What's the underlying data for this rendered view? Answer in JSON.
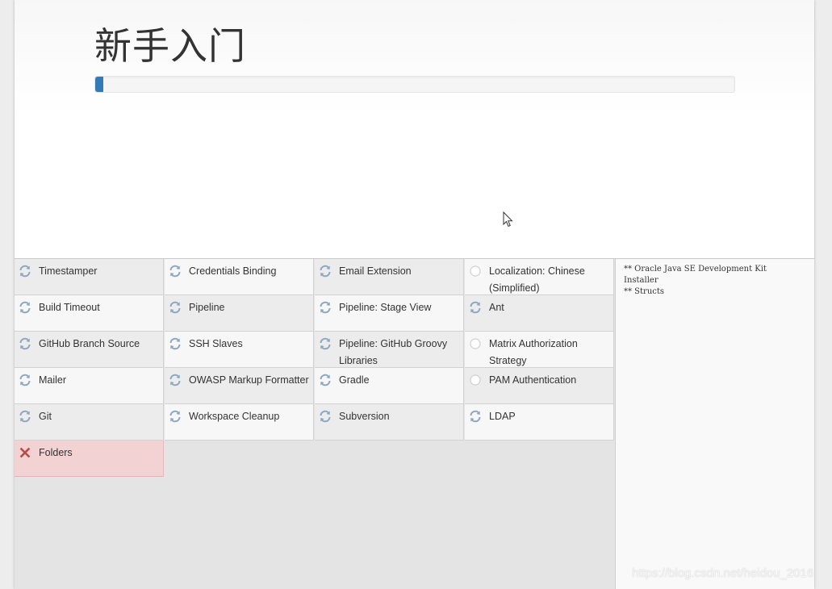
{
  "page": {
    "title": "新手入门",
    "progress_fraction": 0.012,
    "accent_color": "#337ab7"
  },
  "plugins": [
    {
      "label": "Timestamper",
      "status": "installing"
    },
    {
      "label": "Credentials Binding",
      "status": "installing"
    },
    {
      "label": "Email Extension",
      "status": "installing"
    },
    {
      "label": "Localization: Chinese (Simplified)",
      "status": "pending"
    },
    {
      "label": "Build Timeout",
      "status": "installing"
    },
    {
      "label": "Pipeline",
      "status": "installing"
    },
    {
      "label": "Pipeline: Stage View",
      "status": "installing"
    },
    {
      "label": "Ant",
      "status": "installing"
    },
    {
      "label": "GitHub Branch Source",
      "status": "installing"
    },
    {
      "label": "SSH Slaves",
      "status": "installing"
    },
    {
      "label": "Pipeline: GitHub Groovy Libraries",
      "status": "installing"
    },
    {
      "label": "Matrix Authorization Strategy",
      "status": "pending"
    },
    {
      "label": "Mailer",
      "status": "installing"
    },
    {
      "label": "OWASP Markup Formatter",
      "status": "installing"
    },
    {
      "label": "Gradle",
      "status": "installing"
    },
    {
      "label": "PAM Authentication",
      "status": "pending"
    },
    {
      "label": "Git",
      "status": "installing"
    },
    {
      "label": "Workspace Cleanup",
      "status": "installing"
    },
    {
      "label": "Subversion",
      "status": "installing"
    },
    {
      "label": "LDAP",
      "status": "installing"
    },
    {
      "label": "Folders",
      "status": "failed"
    }
  ],
  "log": {
    "lines": [
      "** Oracle Java SE Development Kit",
      "Installer",
      "** Structs"
    ]
  },
  "icons": {
    "installing": "refresh-icon",
    "pending": "circle-icon",
    "failed": "cross-icon"
  },
  "status_colors": {
    "installing": "#8aa6c1",
    "pending": "#cfcfcf",
    "failed": "#b94a48"
  },
  "watermark": "https://blog.csdn.net/heidou_2016"
}
